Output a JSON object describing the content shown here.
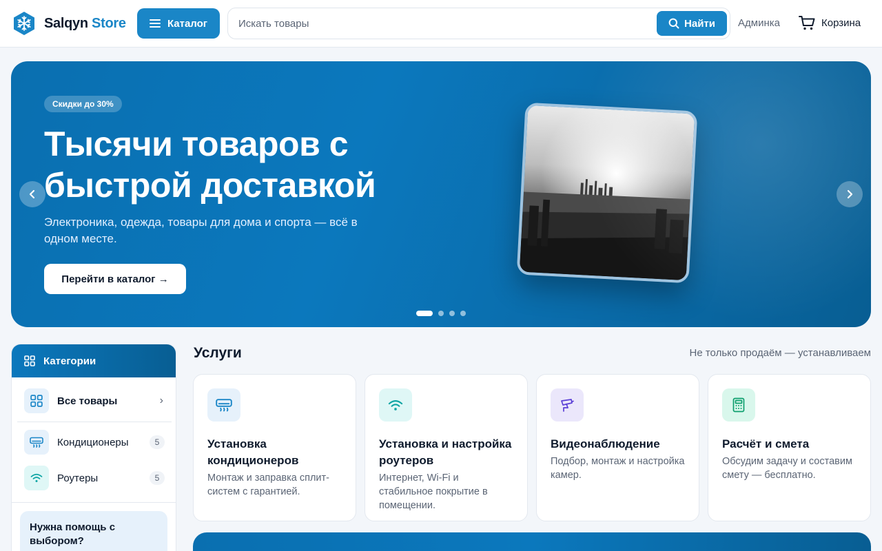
{
  "header": {
    "brand_part1": "Salqyn",
    "brand_part2": "Store",
    "catalog_label": "Каталог",
    "search_placeholder": "Искать товары",
    "search_button": "Найти",
    "admin_label": "Админка",
    "cart_label": "Корзина"
  },
  "hero": {
    "badge": "Скидки до 30%",
    "title": "Тысячи товаров с быстрой доставкой",
    "subtitle": "Электроника, одежда, товары для дома и спорта — всё в одном месте.",
    "cta": "Перейти в каталог →",
    "slides_total": 4,
    "active_slide": 1
  },
  "sidebar": {
    "title": "Категории",
    "items": [
      {
        "label": "Все товары",
        "count": ""
      },
      {
        "label": "Кондиционеры",
        "count": "5"
      },
      {
        "label": "Роутеры",
        "count": "5"
      }
    ],
    "help_title": "Нужна помощь с выбором?"
  },
  "services": {
    "title": "Услуги",
    "note": "Не только продаём — устанавливаем",
    "cards": [
      {
        "title": "Установка кондиционеров",
        "desc": "Монтаж и заправка сплит-систем с гарантией.",
        "icon": "air-conditioner-icon",
        "color": "#1a86c7"
      },
      {
        "title": "Установка и настройка роутеров",
        "desc": "Интернет, Wi-Fi и стабильное покрытие в помещении.",
        "icon": "wifi-icon",
        "color": "#0ea5a4"
      },
      {
        "title": "Видеонаблюдение",
        "desc": "Подбор, монтаж и настройка камер.",
        "icon": "cctv-camera-icon",
        "color": "#5b3fd6"
      },
      {
        "title": "Расчёт и смета",
        "desc": "Обсудим задачу и составим смету — бесплатно.",
        "icon": "calculator-icon",
        "color": "#0e9f6e"
      }
    ]
  },
  "colors": {
    "accent": "#1a86c7",
    "text": "#0f1b2d",
    "muted": "#5b6575",
    "background": "#f3f6fa"
  }
}
